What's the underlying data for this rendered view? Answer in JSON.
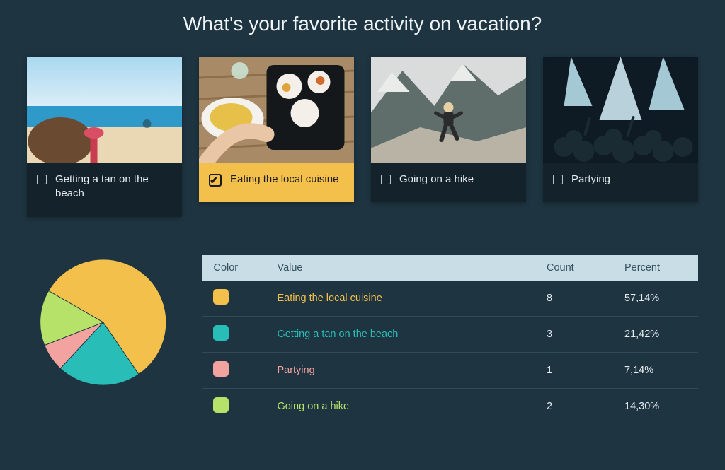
{
  "question": "What's your favorite activity on vacation?",
  "options": [
    {
      "label": "Getting a tan on the beach",
      "selected": false
    },
    {
      "label": "Eating the local cuisine",
      "selected": true
    },
    {
      "label": "Going on a hike",
      "selected": false
    },
    {
      "label": "Partying",
      "selected": false
    }
  ],
  "table": {
    "headers": {
      "color": "Color",
      "value": "Value",
      "count": "Count",
      "percent": "Percent"
    },
    "rows": [
      {
        "color": "#f3c04c",
        "value": "Eating the local cuisine",
        "count": "8",
        "percent": "57,14%"
      },
      {
        "color": "#29bdb8",
        "value": "Getting a tan on the beach",
        "count": "3",
        "percent": "21,42%"
      },
      {
        "color": "#f2a3a0",
        "value": "Partying",
        "count": "1",
        "percent": "7,14%"
      },
      {
        "color": "#b6e26a",
        "value": "Going on a hike",
        "count": "2",
        "percent": "14,30%"
      }
    ]
  },
  "chart_data": {
    "type": "pie",
    "title": "",
    "categories": [
      "Eating the local cuisine",
      "Getting a tan on the beach",
      "Partying",
      "Going on a hike"
    ],
    "values": [
      57.14,
      21.42,
      7.14,
      14.3
    ],
    "colors": [
      "#f3c04c",
      "#29bdb8",
      "#f2a3a0",
      "#b6e26a"
    ]
  }
}
